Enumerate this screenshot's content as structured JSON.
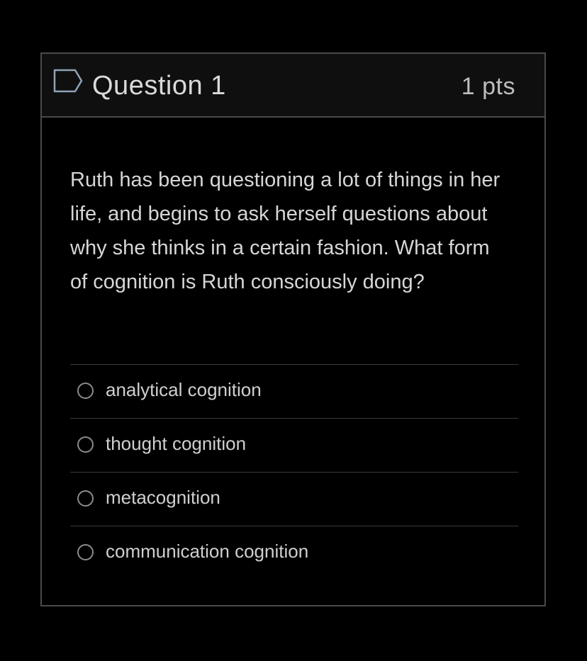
{
  "question": {
    "title": "Question 1",
    "points": "1 pts",
    "flag_icon": "bookmark-flag-icon",
    "text": "Ruth has been questioning a lot of things in her life, and begins to ask herself questions about why she thinks in a certain fashion. What form of cognition is Ruth consciously doing?"
  },
  "answers": [
    {
      "label": "analytical cognition",
      "selected": false
    },
    {
      "label": "thought cognition",
      "selected": false
    },
    {
      "label": "metacognition",
      "selected": false
    },
    {
      "label": "communication cognition",
      "selected": false
    }
  ],
  "colors": {
    "background": "#000000",
    "header_background": "#0f0f0f",
    "border": "#4a4a4a",
    "text": "#d6d6d6"
  }
}
